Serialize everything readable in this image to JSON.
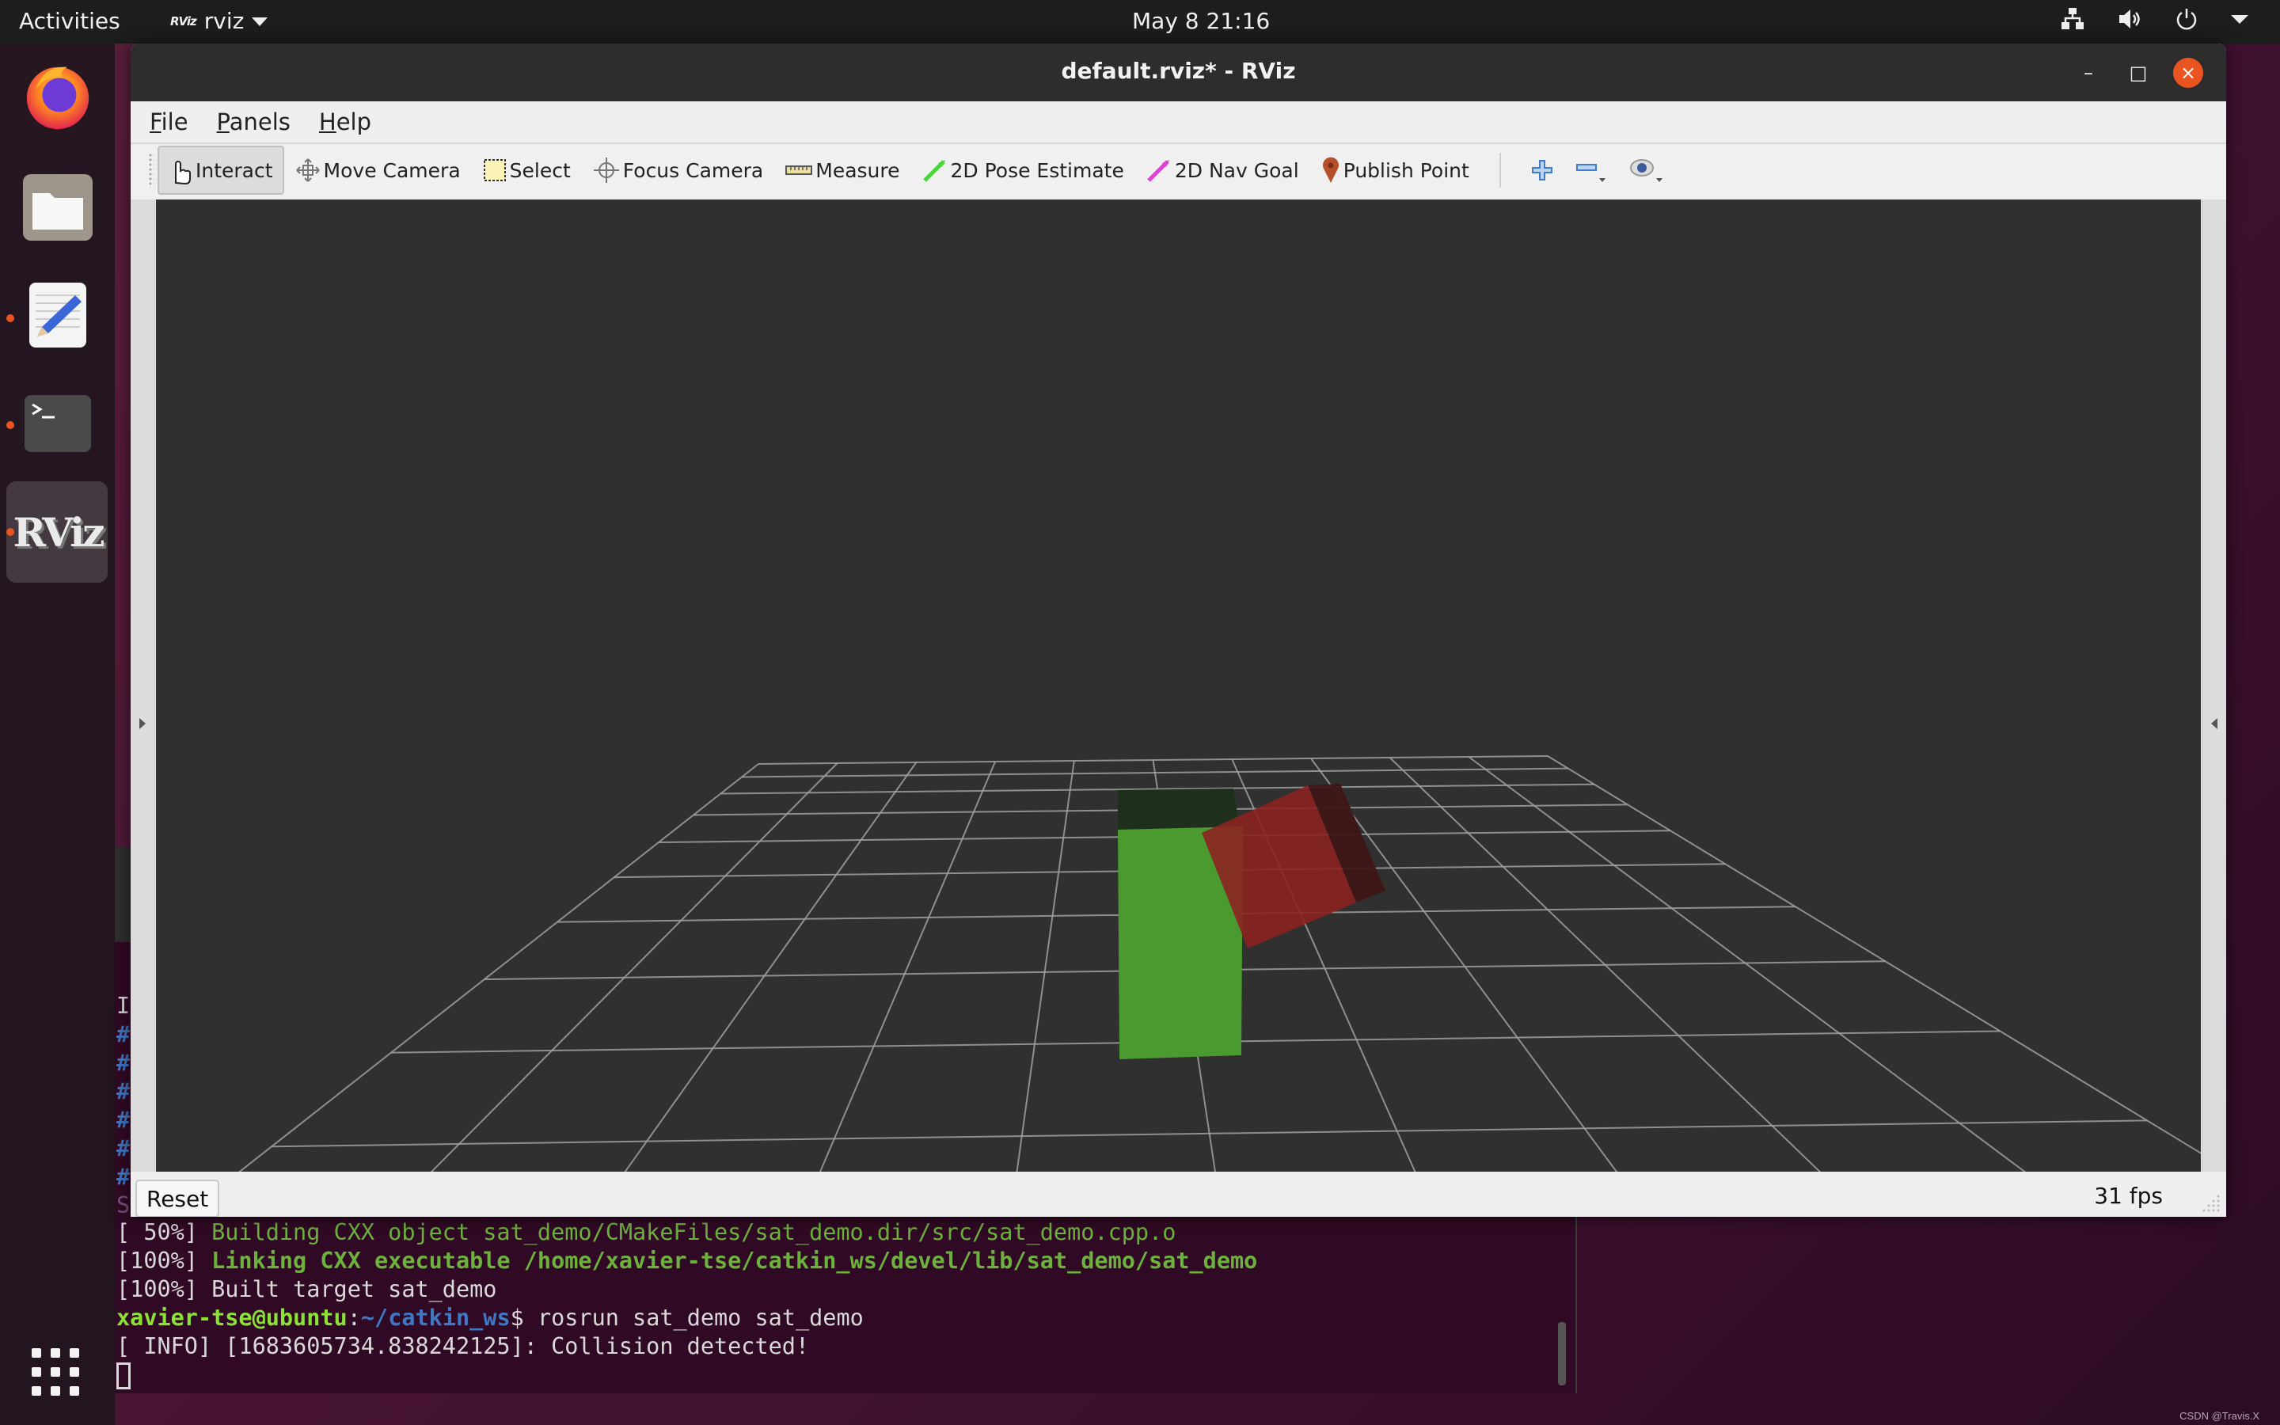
{
  "topbar": {
    "activities": "Activities",
    "app_name": "rviz",
    "app_mini_logo": "RViz",
    "clock": "May 8  21:16",
    "tray_icons": [
      "network-icon",
      "volume-icon",
      "power-icon",
      "chevron-down-icon"
    ]
  },
  "dock": {
    "items": [
      {
        "name": "Firefox",
        "icon": "firefox-icon",
        "running": false
      },
      {
        "name": "Files",
        "icon": "files-icon",
        "running": false
      },
      {
        "name": "Text Editor",
        "icon": "text-editor-icon",
        "running": true
      },
      {
        "name": "Terminal",
        "icon": "terminal-icon",
        "running": true
      },
      {
        "name": "RViz",
        "icon": "rviz-icon",
        "running": true,
        "active": true
      }
    ],
    "app_grid": "show-applications-icon",
    "rviz_label": "RViz"
  },
  "window": {
    "title": "default.rviz* - RViz",
    "controls": {
      "minimize": "–",
      "maximize": "□",
      "close": "×"
    },
    "close_color": "#e95420"
  },
  "menu": {
    "items": [
      {
        "label": "File",
        "mnemonic": "F",
        "rest": "ile"
      },
      {
        "label": "Panels",
        "mnemonic": "P",
        "rest": "anels"
      },
      {
        "label": "Help",
        "mnemonic": "H",
        "rest": "elp"
      }
    ]
  },
  "toolbar": {
    "tools": [
      {
        "label": "Interact",
        "icon": "hand-pointer-icon",
        "active": true
      },
      {
        "label": "Move Camera",
        "icon": "move-camera-icon"
      },
      {
        "label": "Select",
        "icon": "select-icon"
      },
      {
        "label": "Focus Camera",
        "icon": "focus-camera-icon"
      },
      {
        "label": "Measure",
        "icon": "ruler-icon"
      },
      {
        "label": "2D Pose Estimate",
        "icon": "pose-arrow-icon",
        "color": "#4ad63a"
      },
      {
        "label": "2D Nav Goal",
        "icon": "nav-goal-arrow-icon",
        "color": "#e040d8"
      },
      {
        "label": "Publish Point",
        "icon": "map-pin-icon",
        "color": "#b5502a"
      }
    ],
    "extra": [
      "add-tool-icon",
      "remove-tool-icon",
      "view-visibility-icon"
    ]
  },
  "view3d": {
    "background": "#303030",
    "grid_color": "#a0a0a0",
    "objects": [
      {
        "name": "green-box",
        "color": "#4a9a30"
      },
      {
        "name": "red-box",
        "color": "#8b2420"
      }
    ]
  },
  "statusbar": {
    "reset_label": "Reset",
    "fps": "31 fps"
  },
  "terminal": {
    "left_chars": [
      "I",
      "#",
      "#",
      "#",
      "#",
      "#",
      "#",
      "S"
    ],
    "lines": [
      {
        "prefix": "[ 50%] ",
        "text": "Building CXX object sat_demo/CMakeFiles/sat_demo.dir/src/sat_demo.cpp.o",
        "style": "green"
      },
      {
        "prefix": "[100%] ",
        "text": "Linking CXX executable /home/xavier-tse/catkin_ws/devel/lib/sat_demo/sat_demo",
        "style": "green-bold"
      },
      {
        "prefix": "[100%] ",
        "text": "Built target sat_demo",
        "style": "plain"
      },
      {
        "user": "xavier-tse@ubuntu",
        "sep": ":",
        "path": "~/catkin_ws",
        "prompt": "$ ",
        "command": "rosrun sat_demo sat_demo"
      },
      {
        "prefix": "",
        "text": "[ INFO] [1683605734.838242125]: Collision detected!",
        "style": "plain"
      }
    ]
  },
  "watermark": "CSDN @Travis.X"
}
